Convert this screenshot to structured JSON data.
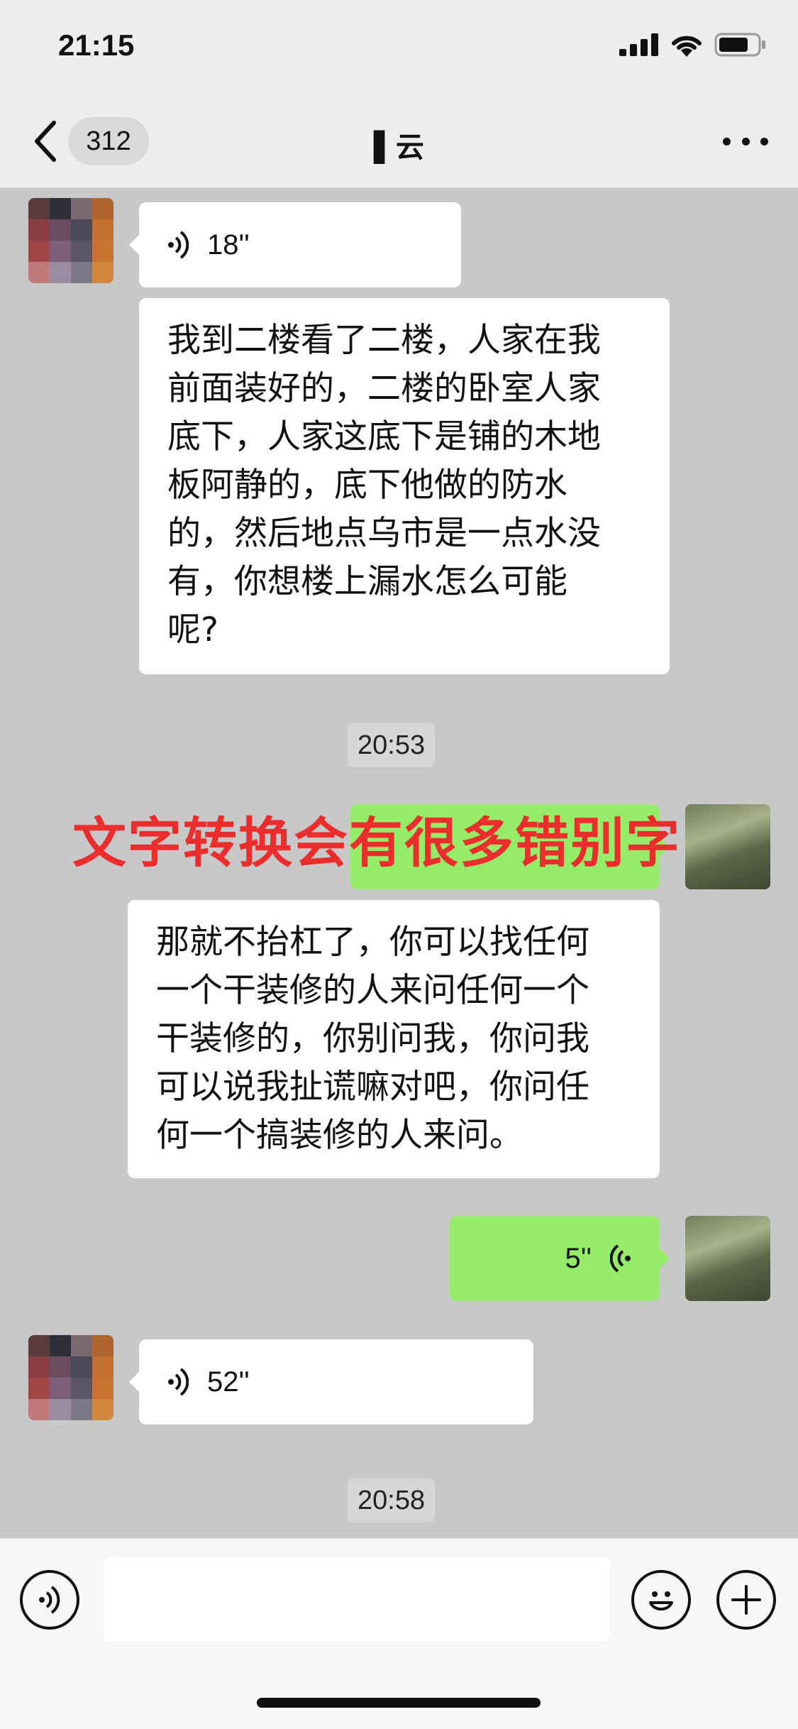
{
  "status_bar": {
    "time": "21:15"
  },
  "nav": {
    "unread_count": "312",
    "title": "▌云"
  },
  "messages": [
    {
      "side": "in",
      "type": "voice",
      "duration": "18''"
    },
    {
      "side": "in",
      "type": "text",
      "lines": [
        "我到二楼看了二楼，人家在我",
        "前面装好的，二楼的卧室人家",
        "底下，人家这底下是铺的木地",
        "板阿静的，底下他做的防水",
        "的，然后地点乌市是一点水没",
        "有，你想楼上漏水怎么可能",
        "呢?"
      ]
    },
    {
      "type": "timestamp",
      "text": "20:53"
    },
    {
      "side": "out",
      "type": "voice-hidden"
    },
    {
      "side": "out",
      "type": "text",
      "lines": [
        "那就不抬杠了，你可以找任何",
        "一个干装修的人来问任何一个",
        "干装修的，你别问我，你问我",
        "可以说我扯谎嘛对吧，你问任",
        "何一个搞装修的人来问。"
      ]
    },
    {
      "side": "out",
      "type": "voice",
      "duration": "5''"
    },
    {
      "side": "in",
      "type": "voice",
      "duration": "52''"
    },
    {
      "type": "timestamp",
      "text": "20:58"
    }
  ],
  "overlay_caption": "文字转换会有很多错别字",
  "input": {
    "placeholder": ""
  },
  "colors": {
    "outgoing_bubble": "#95ec69",
    "incoming_bubble": "#ffffff",
    "caption": "#ec2d2d",
    "chat_background": "#c8c8c8"
  },
  "icons": [
    "back-chevron-icon",
    "more-icon",
    "signal-icon",
    "wifi-icon",
    "battery-icon",
    "voice-wave-icon",
    "voice-mode-icon",
    "emoji-icon",
    "plus-icon"
  ]
}
